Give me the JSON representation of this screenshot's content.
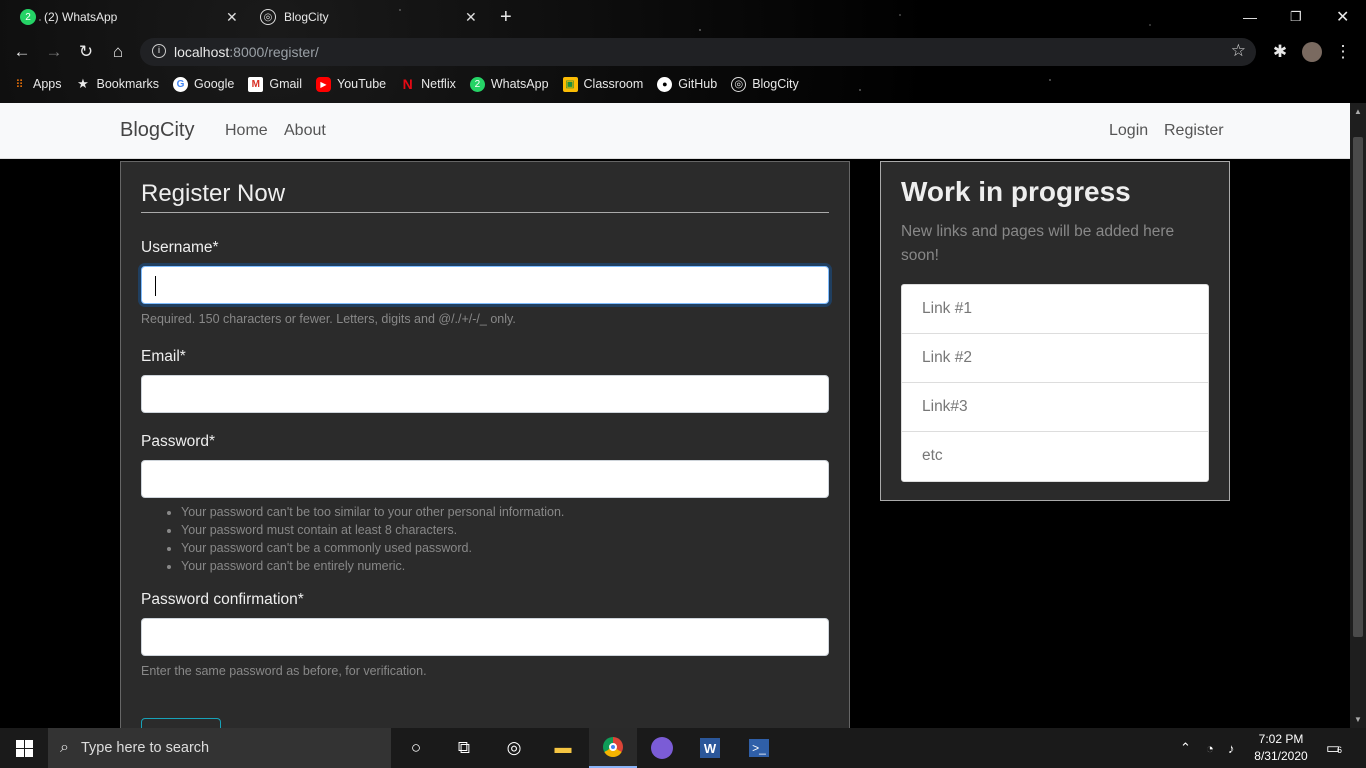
{
  "browser": {
    "tabs": [
      {
        "title": "(2) WhatsApp",
        "favicon": "whatsapp-icon",
        "badge": "2"
      },
      {
        "title": "BlogCity",
        "favicon": "globe-icon"
      }
    ],
    "address": {
      "host": "localhost",
      "path": ":8000/register/"
    },
    "bookmarks": [
      {
        "label": "Apps",
        "icon": "apps-grid-icon"
      },
      {
        "label": "Bookmarks",
        "icon": "star-icon"
      },
      {
        "label": "Google",
        "icon": "google-icon"
      },
      {
        "label": "Gmail",
        "icon": "gmail-icon"
      },
      {
        "label": "YouTube",
        "icon": "youtube-icon"
      },
      {
        "label": "Netflix",
        "icon": "netflix-icon"
      },
      {
        "label": "WhatsApp",
        "icon": "whatsapp-icon"
      },
      {
        "label": "Classroom",
        "icon": "classroom-icon"
      },
      {
        "label": "GitHub",
        "icon": "github-icon"
      },
      {
        "label": "BlogCity",
        "icon": "globe-icon"
      }
    ]
  },
  "site": {
    "brand": "BlogCity",
    "nav": {
      "home": "Home",
      "about": "About",
      "login": "Login",
      "register": "Register"
    }
  },
  "form": {
    "title": "Register Now",
    "username": {
      "label": "Username*",
      "value": "",
      "help": "Required. 150 characters or fewer. Letters, digits and @/./+/-/_ only."
    },
    "email": {
      "label": "Email*",
      "value": ""
    },
    "password": {
      "label": "Password*",
      "value": "",
      "rules": [
        "Your password can't be too similar to your other personal information.",
        "Your password must contain at least 8 characters.",
        "Your password can't be a commonly used password.",
        "Your password can't be entirely numeric."
      ]
    },
    "password_confirm": {
      "label": "Password confirmation*",
      "value": "",
      "help": "Enter the same password as before, for verification."
    }
  },
  "sidebar": {
    "title": "Work in progress",
    "subtitle": "New links and pages will be added here soon!",
    "links": [
      "Link #1",
      "Link #2",
      "Link#3",
      "etc"
    ]
  },
  "taskbar": {
    "search_placeholder": "Type here to search",
    "time": "7:02 PM",
    "date": "8/31/2020",
    "notification_count": "6"
  },
  "colors": {
    "accent": "#17a2b8",
    "card": "#2b2b2b",
    "navbar": "#f8f9fa"
  }
}
